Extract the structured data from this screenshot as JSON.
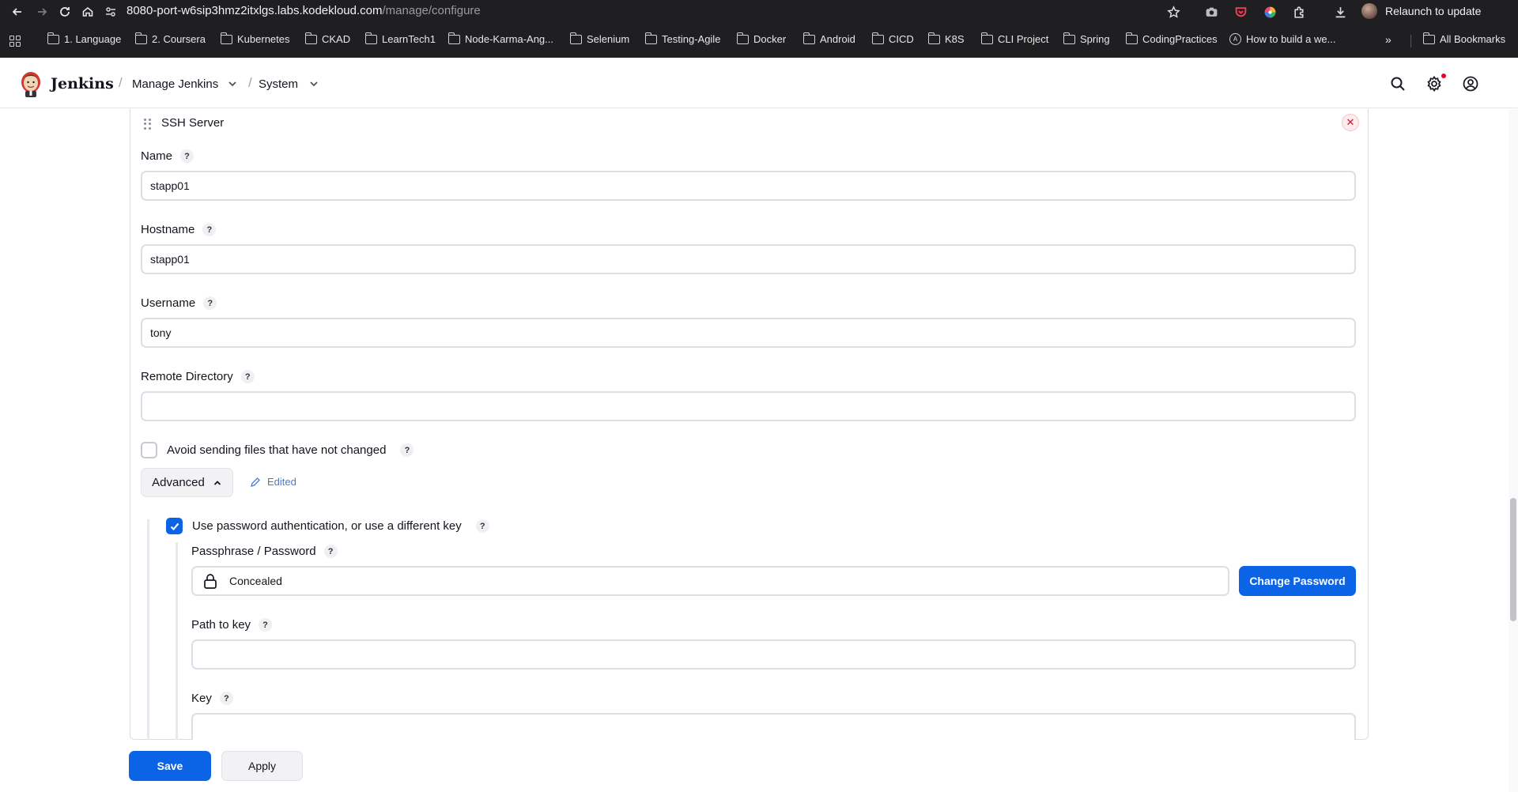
{
  "browser": {
    "url_host": "8080-port-w6sip3hmz2itxlgs.labs.kodekloud.com",
    "url_path": "/manage/configure",
    "relaunch_label": "Relaunch to update",
    "bookmarks": [
      {
        "label": "1. Language"
      },
      {
        "label": "2. Coursera"
      },
      {
        "label": "Kubernetes"
      },
      {
        "label": "CKAD"
      },
      {
        "label": "LearnTech1"
      },
      {
        "label": "Node-Karma-Ang..."
      },
      {
        "label": "Selenium"
      },
      {
        "label": "Testing-Agile"
      },
      {
        "label": "Docker"
      },
      {
        "label": "Android"
      },
      {
        "label": "CICD"
      },
      {
        "label": "K8S"
      },
      {
        "label": "CLI Project"
      },
      {
        "label": "Spring"
      },
      {
        "label": "CodingPractices"
      },
      {
        "label": "How to build a we..."
      }
    ],
    "more_label": "»",
    "all_bookmarks": "All Bookmarks"
  },
  "header": {
    "brand": "Jenkins",
    "breadcrumbs": [
      {
        "label": "Manage Jenkins"
      },
      {
        "label": "System"
      }
    ],
    "icons": [
      "search-icon",
      "gear-icon",
      "user-icon"
    ],
    "notification_color": "#e6002b"
  },
  "ssh_server": {
    "title": "SSH Server",
    "name_label": "Name",
    "name_value": "stapp01",
    "hostname_label": "Hostname",
    "hostname_value": "stapp01",
    "username_label": "Username",
    "username_value": "tony",
    "remote_dir_label": "Remote Directory",
    "remote_dir_value": "",
    "avoid_label": "Avoid sending files that have not changed",
    "avoid_checked": false,
    "advanced_label": "Advanced",
    "edited_label": "Edited",
    "use_password_label": "Use password authentication, or use a different key",
    "use_password_checked": true,
    "passphrase_label": "Passphrase / Password",
    "passphrase_value": "Concealed",
    "change_password_label": "Change Password",
    "path_to_key_label": "Path to key",
    "path_to_key_value": "",
    "key_label": "Key",
    "key_value": "",
    "help_glyph": "?",
    "delete_glyph": "✕"
  },
  "footer": {
    "save_label": "Save",
    "apply_label": "Apply"
  },
  "colors": {
    "primary": "#0b63e5",
    "danger": "#d2102c"
  }
}
